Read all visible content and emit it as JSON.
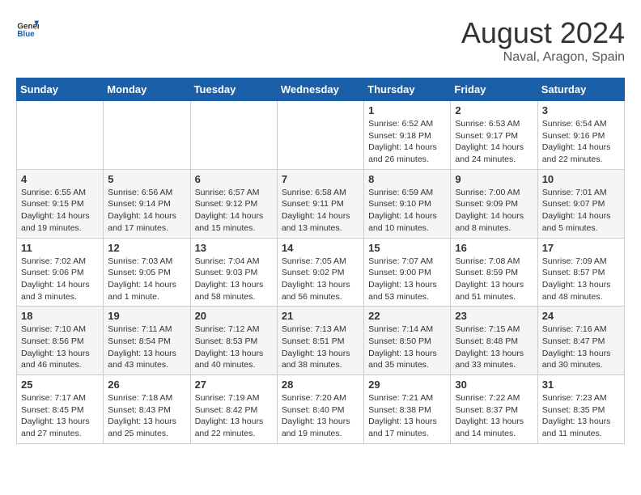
{
  "header": {
    "logo_general": "General",
    "logo_blue": "Blue",
    "title": "August 2024",
    "subtitle": "Naval, Aragon, Spain"
  },
  "days_of_week": [
    "Sunday",
    "Monday",
    "Tuesday",
    "Wednesday",
    "Thursday",
    "Friday",
    "Saturday"
  ],
  "weeks": [
    {
      "days": [
        {
          "number": "",
          "detail": ""
        },
        {
          "number": "",
          "detail": ""
        },
        {
          "number": "",
          "detail": ""
        },
        {
          "number": "",
          "detail": ""
        },
        {
          "number": "1",
          "detail": "Sunrise: 6:52 AM\nSunset: 9:18 PM\nDaylight: 14 hours\nand 26 minutes."
        },
        {
          "number": "2",
          "detail": "Sunrise: 6:53 AM\nSunset: 9:17 PM\nDaylight: 14 hours\nand 24 minutes."
        },
        {
          "number": "3",
          "detail": "Sunrise: 6:54 AM\nSunset: 9:16 PM\nDaylight: 14 hours\nand 22 minutes."
        }
      ]
    },
    {
      "days": [
        {
          "number": "4",
          "detail": "Sunrise: 6:55 AM\nSunset: 9:15 PM\nDaylight: 14 hours\nand 19 minutes."
        },
        {
          "number": "5",
          "detail": "Sunrise: 6:56 AM\nSunset: 9:14 PM\nDaylight: 14 hours\nand 17 minutes."
        },
        {
          "number": "6",
          "detail": "Sunrise: 6:57 AM\nSunset: 9:12 PM\nDaylight: 14 hours\nand 15 minutes."
        },
        {
          "number": "7",
          "detail": "Sunrise: 6:58 AM\nSunset: 9:11 PM\nDaylight: 14 hours\nand 13 minutes."
        },
        {
          "number": "8",
          "detail": "Sunrise: 6:59 AM\nSunset: 9:10 PM\nDaylight: 14 hours\nand 10 minutes."
        },
        {
          "number": "9",
          "detail": "Sunrise: 7:00 AM\nSunset: 9:09 PM\nDaylight: 14 hours\nand 8 minutes."
        },
        {
          "number": "10",
          "detail": "Sunrise: 7:01 AM\nSunset: 9:07 PM\nDaylight: 14 hours\nand 5 minutes."
        }
      ]
    },
    {
      "days": [
        {
          "number": "11",
          "detail": "Sunrise: 7:02 AM\nSunset: 9:06 PM\nDaylight: 14 hours\nand 3 minutes."
        },
        {
          "number": "12",
          "detail": "Sunrise: 7:03 AM\nSunset: 9:05 PM\nDaylight: 14 hours\nand 1 minute."
        },
        {
          "number": "13",
          "detail": "Sunrise: 7:04 AM\nSunset: 9:03 PM\nDaylight: 13 hours\nand 58 minutes."
        },
        {
          "number": "14",
          "detail": "Sunrise: 7:05 AM\nSunset: 9:02 PM\nDaylight: 13 hours\nand 56 minutes."
        },
        {
          "number": "15",
          "detail": "Sunrise: 7:07 AM\nSunset: 9:00 PM\nDaylight: 13 hours\nand 53 minutes."
        },
        {
          "number": "16",
          "detail": "Sunrise: 7:08 AM\nSunset: 8:59 PM\nDaylight: 13 hours\nand 51 minutes."
        },
        {
          "number": "17",
          "detail": "Sunrise: 7:09 AM\nSunset: 8:57 PM\nDaylight: 13 hours\nand 48 minutes."
        }
      ]
    },
    {
      "days": [
        {
          "number": "18",
          "detail": "Sunrise: 7:10 AM\nSunset: 8:56 PM\nDaylight: 13 hours\nand 46 minutes."
        },
        {
          "number": "19",
          "detail": "Sunrise: 7:11 AM\nSunset: 8:54 PM\nDaylight: 13 hours\nand 43 minutes."
        },
        {
          "number": "20",
          "detail": "Sunrise: 7:12 AM\nSunset: 8:53 PM\nDaylight: 13 hours\nand 40 minutes."
        },
        {
          "number": "21",
          "detail": "Sunrise: 7:13 AM\nSunset: 8:51 PM\nDaylight: 13 hours\nand 38 minutes."
        },
        {
          "number": "22",
          "detail": "Sunrise: 7:14 AM\nSunset: 8:50 PM\nDaylight: 13 hours\nand 35 minutes."
        },
        {
          "number": "23",
          "detail": "Sunrise: 7:15 AM\nSunset: 8:48 PM\nDaylight: 13 hours\nand 33 minutes."
        },
        {
          "number": "24",
          "detail": "Sunrise: 7:16 AM\nSunset: 8:47 PM\nDaylight: 13 hours\nand 30 minutes."
        }
      ]
    },
    {
      "days": [
        {
          "number": "25",
          "detail": "Sunrise: 7:17 AM\nSunset: 8:45 PM\nDaylight: 13 hours\nand 27 minutes."
        },
        {
          "number": "26",
          "detail": "Sunrise: 7:18 AM\nSunset: 8:43 PM\nDaylight: 13 hours\nand 25 minutes."
        },
        {
          "number": "27",
          "detail": "Sunrise: 7:19 AM\nSunset: 8:42 PM\nDaylight: 13 hours\nand 22 minutes."
        },
        {
          "number": "28",
          "detail": "Sunrise: 7:20 AM\nSunset: 8:40 PM\nDaylight: 13 hours\nand 19 minutes."
        },
        {
          "number": "29",
          "detail": "Sunrise: 7:21 AM\nSunset: 8:38 PM\nDaylight: 13 hours\nand 17 minutes."
        },
        {
          "number": "30",
          "detail": "Sunrise: 7:22 AM\nSunset: 8:37 PM\nDaylight: 13 hours\nand 14 minutes."
        },
        {
          "number": "31",
          "detail": "Sunrise: 7:23 AM\nSunset: 8:35 PM\nDaylight: 13 hours\nand 11 minutes."
        }
      ]
    }
  ]
}
